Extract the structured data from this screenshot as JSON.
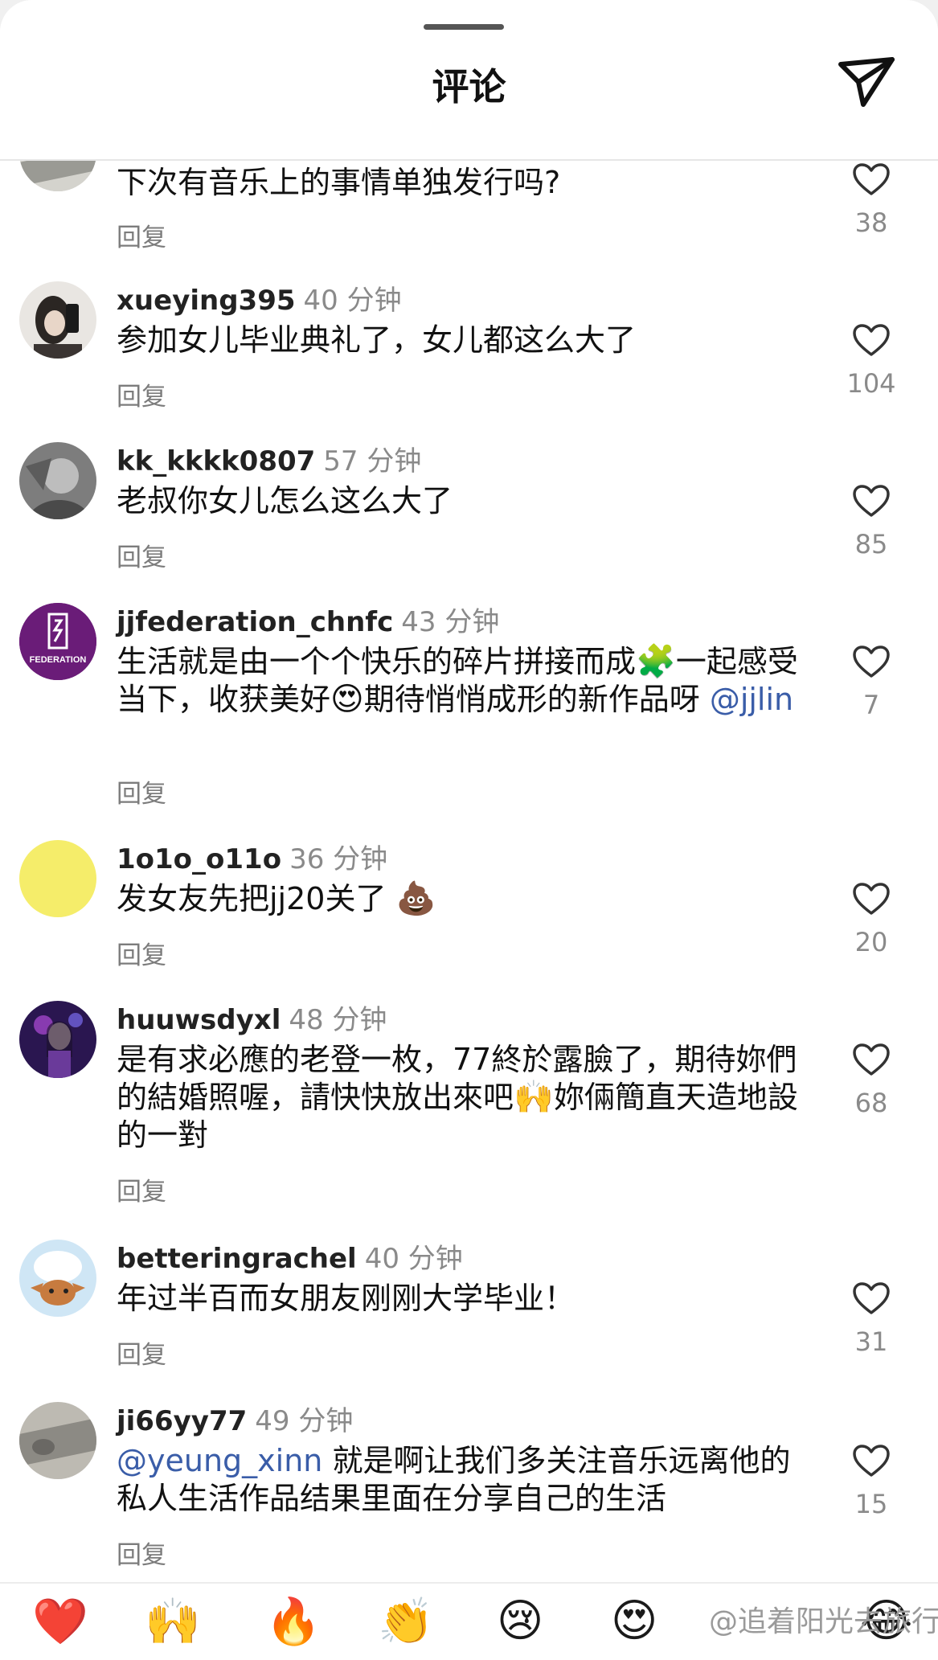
{
  "header": {
    "title": "评论"
  },
  "reply_label": "回复",
  "comments": [
    {
      "user": "",
      "time": "",
      "text": "下次有音乐上的事情单独发行吗?",
      "likes": "38"
    },
    {
      "user": "xueying395",
      "time": "40 分钟",
      "text": "参加女儿毕业典礼了，女儿都这么大了",
      "likes": "104"
    },
    {
      "user": "kk_kkkk0807",
      "time": "57 分钟",
      "text": "老叔你女儿怎么这么大了",
      "likes": "85"
    },
    {
      "user": "jjfederation_chnfc",
      "time": "43 分钟",
      "text_1": "生活就是由一个个快乐的碎片拼接而成",
      "emoji_1": "🧩",
      "text_2": "一起感受当下，收获美好",
      "emoji_2": "😍",
      "text_3": "期待悄悄成形的新作品呀 ",
      "mention": "@jjlin",
      "likes": "7",
      "avatar_text": "FEDERATION"
    },
    {
      "user": "1o1o_o11o",
      "time": "36 分钟",
      "text": "发女友先把jj20关了",
      "emoji": "💩",
      "likes": "20"
    },
    {
      "user": "huuwsdyxl",
      "time": "48 分钟",
      "text_1": "是有求必應的老登一枚，77終於露臉了，期待妳們的結婚照喔，請快快放出來吧",
      "emoji": "🙌",
      "text_2": "妳倆簡直天造地設的一對",
      "likes": "68"
    },
    {
      "user": "betteringrachel",
      "time": "40 分钟",
      "text": "年过半百而女朋友刚刚大学毕业！",
      "likes": "31"
    },
    {
      "user": "ji66yy77",
      "time": "49 分钟",
      "mention": "@yeung_xinn",
      "text": " 就是啊让我们多关注音乐远离他的私人生活作品结果里面在分享自己的生活",
      "likes": "15"
    }
  ],
  "emoji_bar": [
    "❤️",
    "🙌",
    "🔥",
    "👏",
    "😢",
    "😍",
    "😂"
  ],
  "watermark": "@追着阳光去旅行呀",
  "colors": {
    "mention": "#3a5da8",
    "muted": "#8a8a8a",
    "heart_stroke": "#333333"
  }
}
